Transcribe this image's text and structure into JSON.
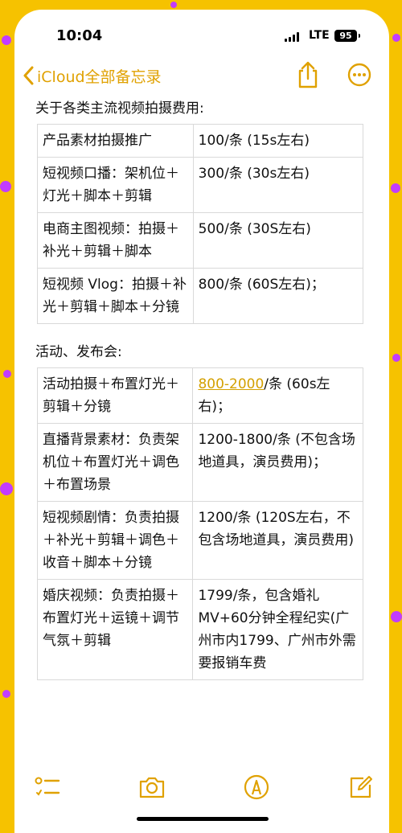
{
  "status_bar": {
    "time": "10:04",
    "network": "LTE",
    "battery": "95"
  },
  "nav": {
    "back_label": "iCloud全部备忘录"
  },
  "sections": [
    {
      "title": "关于各类主流视频拍摄费用:",
      "rows": [
        {
          "item": "产品素材拍摄推广",
          "price": "100/条 (15s左右)"
        },
        {
          "item": "短视频口播：架机位＋灯光＋脚本＋剪辑",
          "price": "300/条 (30s左右)"
        },
        {
          "item": "电商主图视频：拍摄＋补光＋剪辑＋脚本",
          "price": "500/条 (30S左右)"
        },
        {
          "item": "短视频 Vlog：拍摄＋补光＋剪辑＋脚本＋分镜",
          "price": "800/条 (60S左右)；"
        }
      ]
    },
    {
      "title": "活动、发布会:",
      "rows": [
        {
          "item": "活动拍摄＋布置灯光＋剪辑＋分镜",
          "price_link": "800-2000",
          "price": "/条 (60s左右)；"
        },
        {
          "item": "直播背景素材：负责架机位＋布置灯光＋调色＋布置场景",
          "price": "1200-1800/条 (不包含场地道具，演员费用)；"
        },
        {
          "item": "短视频剧情：负责拍摄＋补光＋剪辑＋调色＋收音＋脚本＋分镜",
          "price": "1200/条 (120S左右，不包含场地道具，演员费用)"
        },
        {
          "item": "婚庆视频：负责拍摄＋布置灯光＋运镜＋调节气氛＋剪辑",
          "price": "1799/条，包含婚礼MV+60分钟全程纪实(广州市内1799、广州市外需要报销车费"
        }
      ]
    }
  ],
  "icons": {
    "back": "chevron-left-icon",
    "share": "share-icon",
    "more": "ellipsis-circle-icon",
    "checklist": "checklist-icon",
    "camera": "camera-icon",
    "markup": "markup-pen-icon",
    "compose": "compose-icon"
  },
  "colors": {
    "accent": "#e0a100",
    "background": "#f6c200",
    "dots": "#c23cff"
  }
}
